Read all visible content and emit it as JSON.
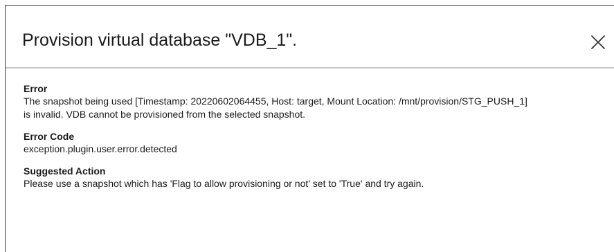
{
  "dialog": {
    "title": "Provision virtual database \"VDB_1\".",
    "close_icon": "close-icon"
  },
  "error": {
    "label": "Error",
    "line1": "The snapshot being used [Timestamp: 20220602064455, Host: target, Mount Location: /mnt/provision/STG_PUSH_1]",
    "line2": "is invalid. VDB cannot be provisioned from the selected snapshot."
  },
  "error_code": {
    "label": "Error Code",
    "value": "exception.plugin.user.error.detected"
  },
  "suggested_action": {
    "label": "Suggested Action",
    "value": "Please use a snapshot which has 'Flag to allow provisioning or not' set to 'True' and try again."
  }
}
